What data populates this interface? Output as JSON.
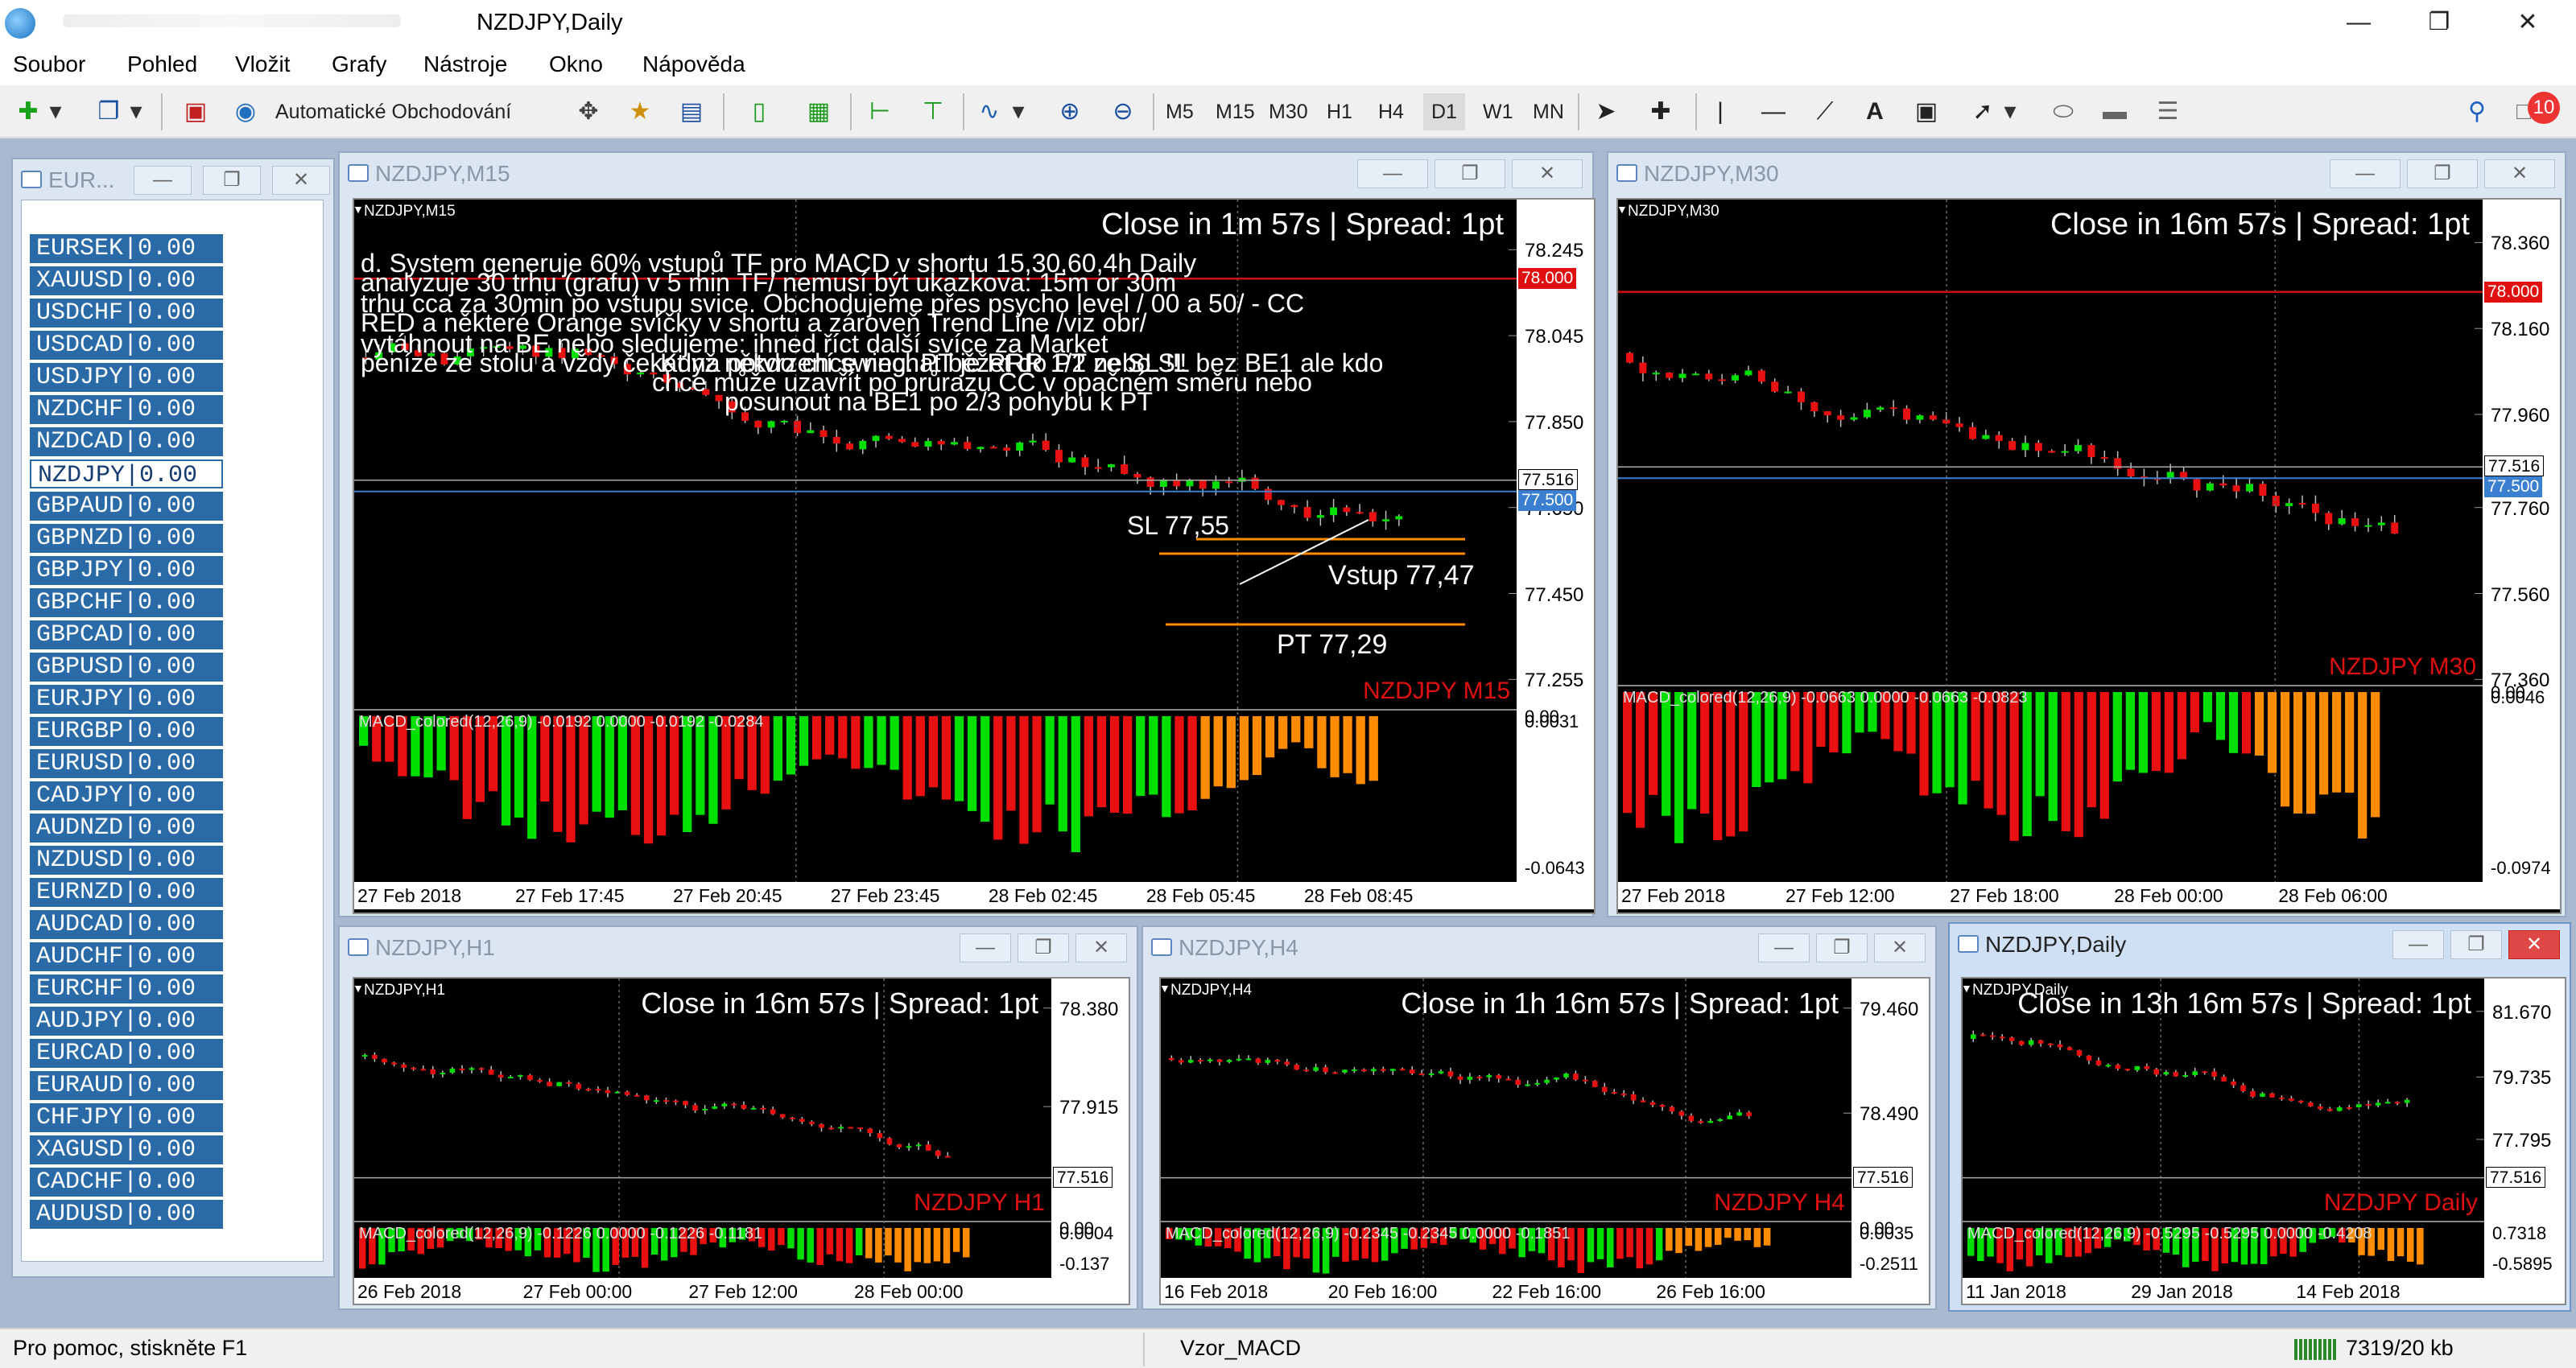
{
  "app": {
    "title": "NZDJPY,Daily"
  },
  "menu": [
    "Soubor",
    "Pohled",
    "Vložit",
    "Grafy",
    "Nástroje",
    "Okno",
    "Nápověda"
  ],
  "toolbar": {
    "auto_trading": "Automatické Obchodování",
    "timeframes": [
      "M5",
      "M15",
      "M30",
      "H1",
      "H4",
      "D1",
      "W1",
      "MN"
    ],
    "notification_count": "10"
  },
  "market_watch": {
    "title": "EUR...",
    "rows": [
      "EURSEK|0.00",
      "XAUUSD|0.00",
      "USDCHF|0.00",
      "USDCAD|0.00",
      "USDJPY|0.00",
      "NZDCHF|0.00",
      "NZDCAD|0.00",
      "NZDJPY|0.00",
      "GBPAUD|0.00",
      "GBPNZD|0.00",
      "GBPJPY|0.00",
      "GBPCHF|0.00",
      "GBPCAD|0.00",
      "GBPUSD|0.00",
      "EURJPY|0.00",
      "EURGBP|0.00",
      "EURUSD|0.00",
      "CADJPY|0.00",
      "AUDNZD|0.00",
      "NZDUSD|0.00",
      "EURNZD|0.00",
      "AUDCAD|0.00",
      "AUDCHF|0.00",
      "EURCHF|0.00",
      "AUDJPY|0.00",
      "EURCAD|0.00",
      "EURAUD|0.00",
      "CHFJPY|0.00",
      "XAGUSD|0.00",
      "CADCHF|0.00",
      "AUDUSD|0.00"
    ],
    "selected": 7
  },
  "colors": {
    "bull": "#00e000",
    "bear": "#e81010",
    "orange": "#ff8c00",
    "bid": "#3a7fd0"
  },
  "windows": [
    {
      "id": "m15",
      "title": "NZDJPY,M15",
      "symbol": "NZDJPY,M15",
      "tf_label": "NZDJPY M15",
      "header": "Close in 1m 57s | Spread: 1pt",
      "yticks": [
        "78.245",
        "78.045",
        "77.850",
        "77.650",
        "77.450",
        "77.255"
      ],
      "ask": "77.516",
      "bid": "77.500",
      "line_label": "78.000",
      "macd_text": "MACD_colored(12,26,9) -0.0192 0.0000 -0.0192 -0.0284",
      "macd_top": "0.0031",
      "macd_top2": "0.00",
      "macd_bottom": "-0.0643",
      "xticks": [
        "27 Feb 2018",
        "27 Feb 17:45",
        "27 Feb 20:45",
        "27 Feb 23:45",
        "28 Feb 02:45",
        "28 Feb 05:45",
        "28 Feb 08:45"
      ],
      "annotations": {
        "a1": "d. System generuje 60% vstupů TF pro MACD v shortu 15,30,60,4h Daily",
        "a2": "analyzuje 30 trhu (grafu) v 5 min TF/ nemusí být ukazkova: 15m or 30m",
        "a3": "trhu cca za 30min po vstupu svice. Obchodujeme přes psycho level / 00 a 50/ - CC",
        "a4": "RED a některé Orange svíčky v shortu a zároveň Trend Line /viz obr/",
        "a5": "vytáhnout na BE nebo sledujeme: ihned říct další svíce za Market",
        "a6": "peníze ze stolu a vždy čekat na potvrzení swing. PT je RRR 1/2 ze SL !!!",
        "a7": "Když někdo chce nechat běžet do PT nebo SL bez BE1 ale kdo",
        "a8": "chce může uzavřít po průrazu CC v opačném směru nebo",
        "a9": "posunout na BE1 po 2/3 pohybu k PT",
        "sl": "SL  77,55",
        "entry": "Vstup 77,47",
        "pt": "PT  77,29"
      }
    },
    {
      "id": "m30",
      "title": "NZDJPY,M30",
      "symbol": "NZDJPY,M30",
      "tf_label": "NZDJPY M30",
      "header": "Close in 16m 57s | Spread: 1pt",
      "yticks": [
        "78.360",
        "78.160",
        "77.960",
        "77.760",
        "77.560",
        "77.360"
      ],
      "ask": "77.516",
      "bid": "77.500",
      "line_label": "78.000",
      "macd_text": "MACD_colored(12,26,9) -0.0663 0.0000 -0.0663 -0.0823",
      "macd_top": "0.0046",
      "macd_top2": "0.00",
      "macd_bottom": "-0.0974",
      "xticks": [
        "27 Feb 2018",
        "27 Feb 12:00",
        "27 Feb 18:00",
        "28 Feb 00:00",
        "28 Feb 06:00"
      ]
    },
    {
      "id": "h1",
      "title": "NZDJPY,H1",
      "symbol": "NZDJPY,H1",
      "tf_label": "NZDJPY H1",
      "header": "Close in 16m 57s | Spread: 1pt",
      "yticks": [
        "78.380",
        "77.915"
      ],
      "ask": "77.516",
      "macd_text": "MACD_colored(12,26,9) -0.1226 0.0000 -0.1226 -0.1181",
      "macd_top": "0.0004",
      "macd_top2": "0.00",
      "macd_bottom": "-0.137",
      "xticks": [
        "26 Feb 2018",
        "27 Feb 00:00",
        "27 Feb 12:00",
        "28 Feb 00:00"
      ]
    },
    {
      "id": "h4",
      "title": "NZDJPY,H4",
      "symbol": "NZDJPY,H4",
      "tf_label": "NZDJPY H4",
      "header": "Close in 1h 16m 57s | Spread: 1pt",
      "yticks": [
        "79.460",
        "78.490"
      ],
      "ask": "77.516",
      "macd_text": "MACD_colored(12,26,9) -0.2345 -0.2345 0.0000 -0.1851",
      "macd_top": "0.0035",
      "macd_top2": "0.00",
      "macd_bottom": "-0.2511",
      "xticks": [
        "16 Feb 2018",
        "20 Feb 16:00",
        "22 Feb 16:00",
        "26 Feb 16:00"
      ]
    },
    {
      "id": "d1",
      "title": "NZDJPY,Daily",
      "symbol": "NZDJPY,Daily",
      "tf_label": "NZDJPY Daily",
      "header": "Close in 13h 16m 57s | Spread: 1pt",
      "yticks": [
        "81.670",
        "79.735",
        "77.795"
      ],
      "ask": "77.516",
      "macd_text": "MACD_colored(12,26,9) -0.5295 -0.5295 0.0000 -0.4208",
      "macd_top": "0.7318",
      "macd_bottom": "-0.5895",
      "xticks": [
        "11 Jan 2018",
        "29 Jan 2018",
        "14 Feb 2018"
      ]
    }
  ],
  "status": {
    "help": "Pro pomoc, stiskněte F1",
    "profile": "Vzor_MACD",
    "traffic": "7319/20 kb"
  }
}
